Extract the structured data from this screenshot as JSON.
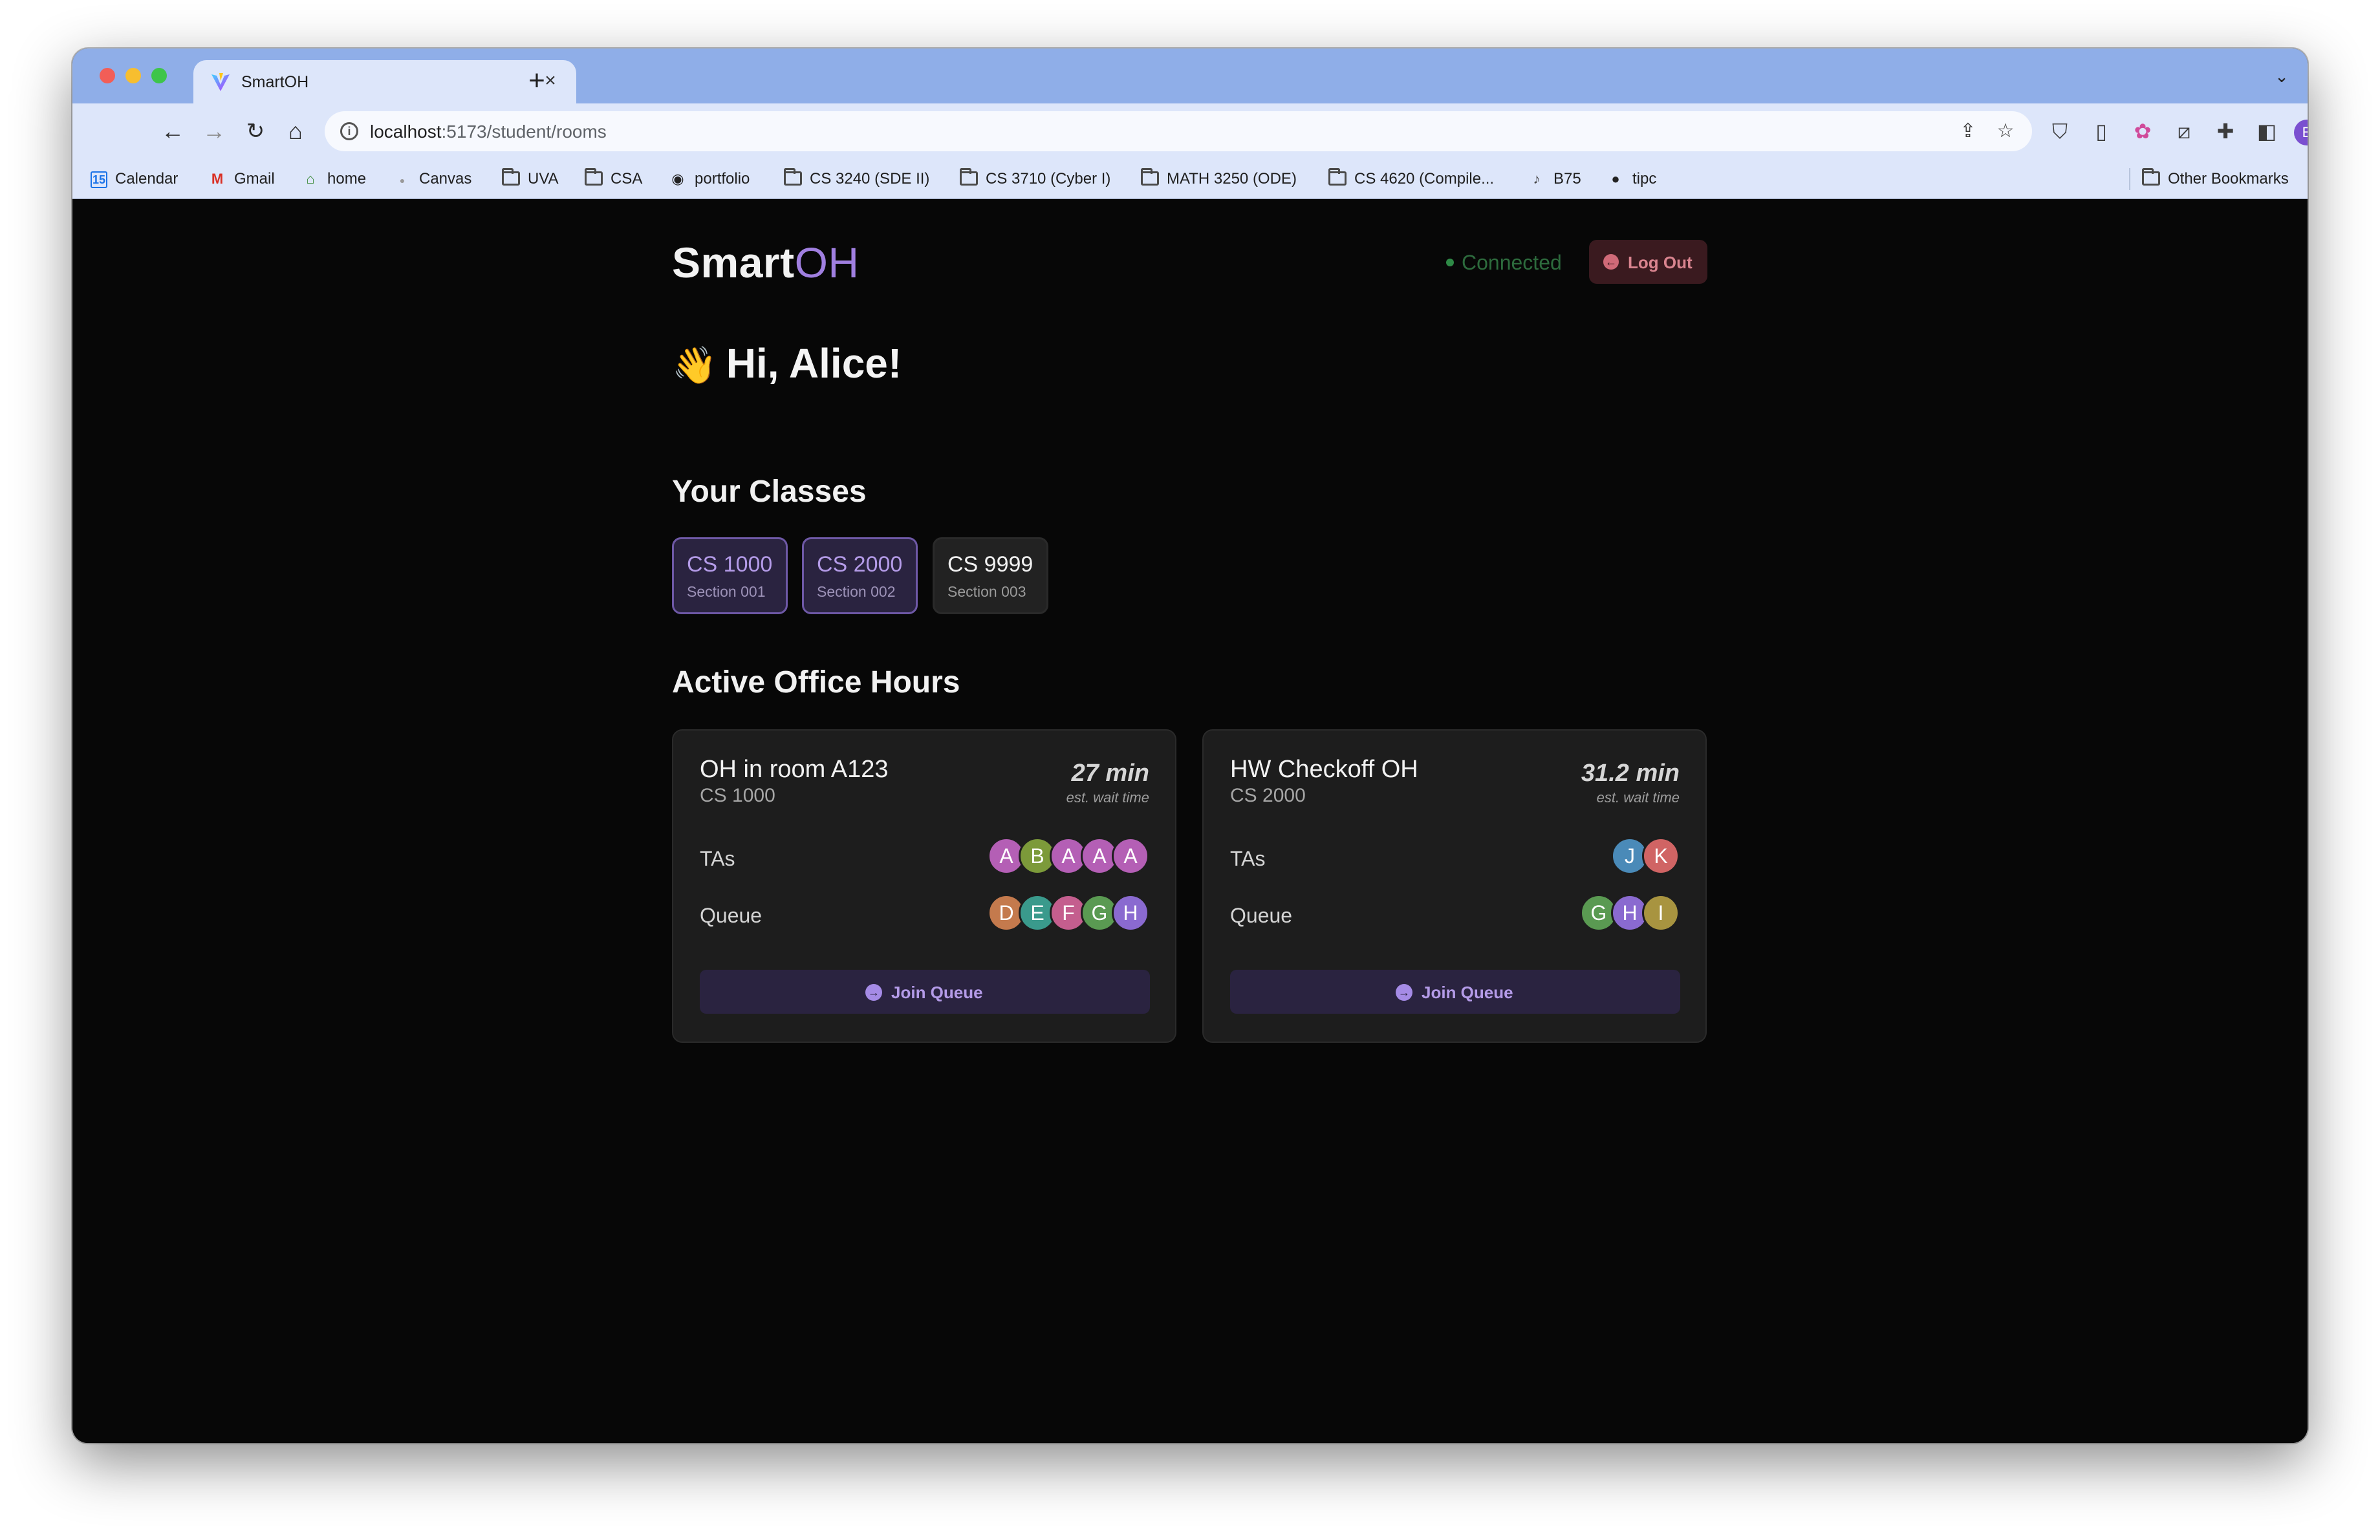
{
  "browser": {
    "tab_title": "SmartOH",
    "url_host": "localhost",
    "url_path": ":5173/student/rooms",
    "bookmarks": [
      {
        "label": "Calendar",
        "icon": "calendar-icon"
      },
      {
        "label": "Gmail",
        "icon": "gmail-icon"
      },
      {
        "label": "home",
        "icon": "home-icon"
      },
      {
        "label": "Canvas",
        "icon": "canvas-icon"
      },
      {
        "label": "UVA",
        "icon": "folder-icon"
      },
      {
        "label": "CSA",
        "icon": "folder-icon"
      },
      {
        "label": "portfolio",
        "icon": "globe-icon"
      },
      {
        "label": "CS 3240 (SDE II)",
        "icon": "folder-icon"
      },
      {
        "label": "CS 3710 (Cyber I)",
        "icon": "folder-icon"
      },
      {
        "label": "MATH 3250 (ODE)",
        "icon": "folder-icon"
      },
      {
        "label": "CS 4620 (Compile...",
        "icon": "folder-icon"
      },
      {
        "label": "B75",
        "icon": "bell-icon"
      },
      {
        "label": "tipc",
        "icon": "github-icon"
      }
    ],
    "other_bookmarks": "Other Bookmarks",
    "profile_initial": "E"
  },
  "header": {
    "logo_main": "Smart",
    "logo_accent": "OH",
    "status": "Connected",
    "logout_label": "Log Out"
  },
  "greeting": {
    "emoji": "👋",
    "text": "Hi, Alice!"
  },
  "classes": {
    "title": "Your Classes",
    "items": [
      {
        "code": "CS 1000",
        "section": "Section 001",
        "enrolled": true
      },
      {
        "code": "CS 2000",
        "section": "Section 002",
        "enrolled": true
      },
      {
        "code": "CS 9999",
        "section": "Section 003",
        "enrolled": false
      }
    ]
  },
  "office_hours": {
    "title": "Active Office Hours",
    "tas_label": "TAs",
    "queue_label": "Queue",
    "wait_label": "est. wait time",
    "join_label": "Join Queue",
    "rooms": [
      {
        "name": "OH in room A123",
        "course": "CS 1000",
        "wait": "27 min",
        "tas": [
          {
            "initial": "A",
            "color": "#b45fb5"
          },
          {
            "initial": "B",
            "color": "#7c9a3a"
          },
          {
            "initial": "A",
            "color": "#b45fb5"
          },
          {
            "initial": "A",
            "color": "#b45fb5"
          },
          {
            "initial": "A",
            "color": "#b45fb5"
          }
        ],
        "queue": [
          {
            "initial": "D",
            "color": "#c47a4d"
          },
          {
            "initial": "E",
            "color": "#3a9a8c"
          },
          {
            "initial": "F",
            "color": "#c45e8e"
          },
          {
            "initial": "G",
            "color": "#5a9a52"
          },
          {
            "initial": "H",
            "color": "#8a6ad0"
          }
        ]
      },
      {
        "name": "HW Checkoff OH",
        "course": "CS 2000",
        "wait": "31.2 min",
        "tas": [
          {
            "initial": "J",
            "color": "#4a8ab8"
          },
          {
            "initial": "K",
            "color": "#d06464"
          }
        ],
        "queue": [
          {
            "initial": "G",
            "color": "#5a9a52"
          },
          {
            "initial": "H",
            "color": "#8a6ad0"
          },
          {
            "initial": "I",
            "color": "#a89440"
          }
        ]
      }
    ]
  }
}
